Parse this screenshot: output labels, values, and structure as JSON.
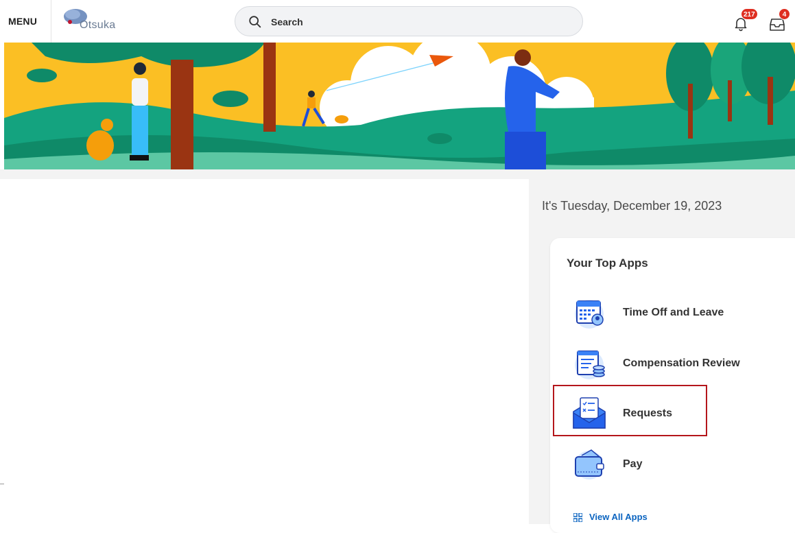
{
  "header": {
    "menu_label": "MENU",
    "logo_text": "Otsuka",
    "search_placeholder": "Search",
    "notifications_count": "217",
    "inbox_count": "4"
  },
  "main": {
    "date_text": "It's Tuesday, December 19, 2023",
    "top_apps_title": "Your Top Apps",
    "apps": [
      {
        "label": "Time Off and Leave",
        "icon": "calendar-icon"
      },
      {
        "label": "Compensation Review",
        "icon": "compensation-icon"
      },
      {
        "label": "Requests",
        "icon": "requests-envelope-icon"
      },
      {
        "label": "Pay",
        "icon": "wallet-icon"
      }
    ],
    "view_all_label": "View All Apps"
  },
  "colors": {
    "badge": "#de2e21",
    "link": "#0b64c0",
    "highlight_border": "#b4161b",
    "banner_yellow": "#fbbf24",
    "banner_green": "#1aa57a"
  }
}
